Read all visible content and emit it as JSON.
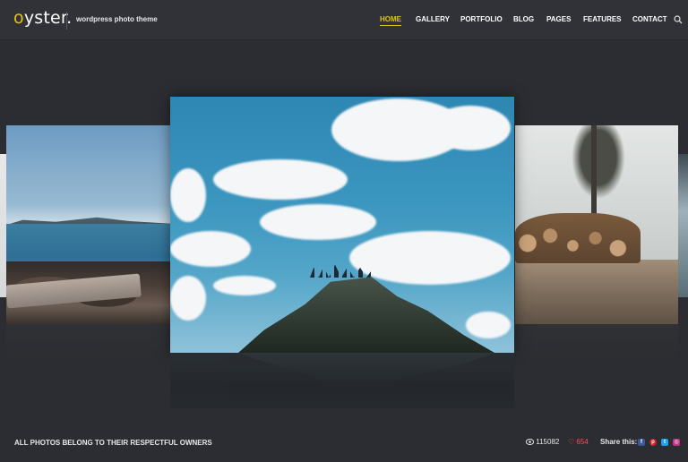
{
  "header": {
    "logo_first": "o",
    "logo_rest": "yster.",
    "tagline": "wordpress photo theme",
    "nav": [
      "HOME",
      "GALLERY",
      "PORTFOLIO",
      "BLOG",
      "PAGES",
      "FEATURES",
      "CONTACT"
    ],
    "active_nav": "HOME",
    "search_icon": "search-icon",
    "accent_color": "#e1c21a"
  },
  "slider": {
    "slides": [
      {
        "name": "sea-rocks-photo"
      },
      {
        "name": "mountain-peak-sky-photo"
      },
      {
        "name": "forest-log-pile-photo"
      }
    ],
    "active_index": 1
  },
  "footer": {
    "copyright": "ALL PHOTOS BELONG TO THEIR RESPECTFUL OWNERS",
    "views": "115082",
    "likes": "654",
    "share_label": "Share this:",
    "share_icons": [
      "facebook-icon",
      "pinterest-icon",
      "twitter-icon",
      "instagram-icon"
    ],
    "likes_color": "#e05a5a"
  }
}
